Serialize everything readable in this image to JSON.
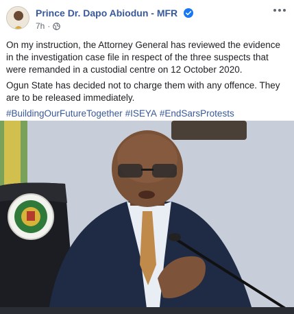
{
  "post": {
    "author": "Prince Dr. Dapo Abiodun - MFR",
    "time": "7h",
    "separator": "·",
    "paragraphs": [
      "On my instruction, the Attorney General has reviewed the evidence in the investigation case file in respect of the three suspects that were remanded in a custodial centre on 12 October 2020.",
      "Ogun State has decided not to charge them with any offence. They are to be released immediately."
    ],
    "hashtags": [
      "#BuildingOurFutureTogether",
      "#ISEYA",
      "#EndSarsProtests"
    ]
  },
  "icons": {
    "verified": "verified-badge-icon",
    "audience": "globe-icon",
    "more": "more-options-icon"
  },
  "colors": {
    "link_blue": "#385898",
    "verified_blue": "#1877f2",
    "meta_gray": "#606770",
    "text": "#1c1e21"
  }
}
